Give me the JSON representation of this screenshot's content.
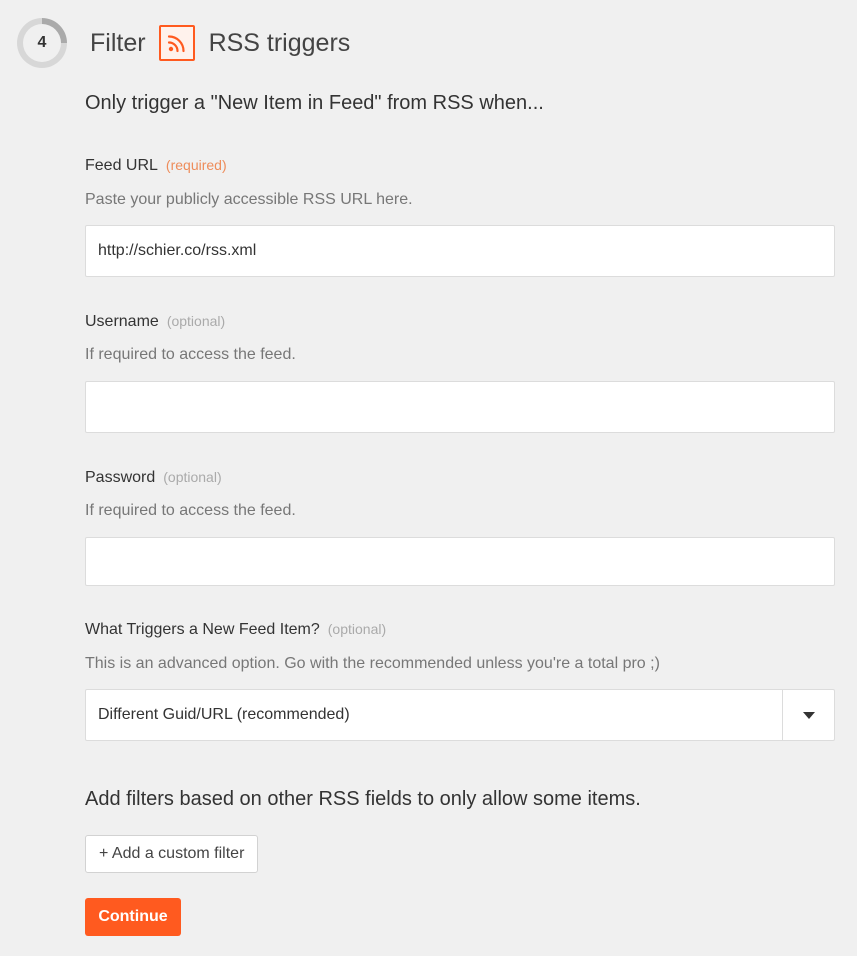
{
  "step": {
    "number": "4",
    "label": "Filter",
    "app_name": "RSS triggers",
    "app_icon": "rss-icon",
    "accent_color": "#ff5a1f"
  },
  "intro": "Only trigger a \"New Item in Feed\" from RSS when...",
  "fields": {
    "feed_url": {
      "label": "Feed URL",
      "tag": "(required)",
      "help": "Paste your publicly accessible RSS URL here.",
      "value": "http://schier.co/rss.xml"
    },
    "username": {
      "label": "Username",
      "tag": "(optional)",
      "help": "If required to access the feed.",
      "value": ""
    },
    "password": {
      "label": "Password",
      "tag": "(optional)",
      "help": "If required to access the feed.",
      "value": ""
    },
    "trigger_type": {
      "label": "What Triggers a New Feed Item?",
      "tag": "(optional)",
      "help": "This is an advanced option. Go with the recommended unless you're a total pro ;)",
      "value": "Different Guid/URL (recommended)"
    }
  },
  "filters": {
    "text": "Add filters based on other RSS fields to only allow some items.",
    "add_button": "+ Add a custom filter"
  },
  "continue_button": "Continue"
}
